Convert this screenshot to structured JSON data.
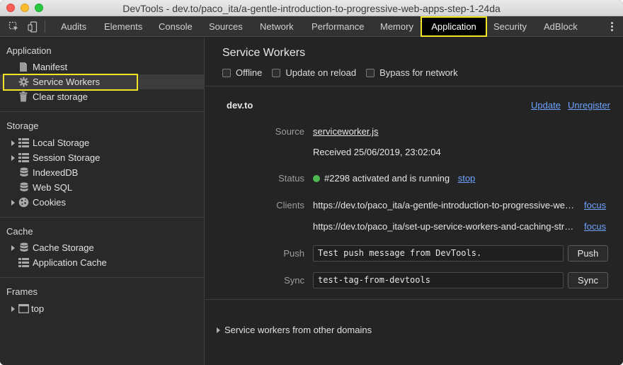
{
  "window": {
    "title": "DevTools - dev.to/paco_ita/a-gentle-introduction-to-progressive-web-apps-step-1-24da"
  },
  "toolbar": {
    "tabs": [
      "Audits",
      "Elements",
      "Console",
      "Sources",
      "Network",
      "Performance",
      "Memory",
      "Application",
      "Security",
      "AdBlock"
    ],
    "active_tab": "Application"
  },
  "sidebar": {
    "application": {
      "title": "Application",
      "items": [
        "Manifest",
        "Service Workers",
        "Clear storage"
      ],
      "selected": "Service Workers"
    },
    "storage": {
      "title": "Storage",
      "items": [
        "Local Storage",
        "Session Storage",
        "IndexedDB",
        "Web SQL",
        "Cookies"
      ]
    },
    "cache": {
      "title": "Cache",
      "items": [
        "Cache Storage",
        "Application Cache"
      ]
    },
    "frames": {
      "title": "Frames",
      "items": [
        "top"
      ]
    }
  },
  "main": {
    "title": "Service Workers",
    "checkboxes": {
      "offline": "Offline",
      "update_on_reload": "Update on reload",
      "bypass_for_network": "Bypass for network"
    },
    "origin": "dev.to",
    "update_link": "Update",
    "unregister_link": "Unregister",
    "source": {
      "label": "Source",
      "file": "serviceworker.js",
      "received": "Received 25/06/2019, 23:02:04"
    },
    "status": {
      "label": "Status",
      "text": "#2298 activated and is running",
      "stop_link": "stop"
    },
    "clients": {
      "label": "Clients",
      "items": [
        "https://dev.to/paco_ita/a-gentle-introduction-to-progressive-we…",
        "https://dev.to/paco_ita/set-up-service-workers-and-caching-str…"
      ],
      "focus_label": "focus"
    },
    "push": {
      "label": "Push",
      "value": "Test push message from DevTools.",
      "button": "Push"
    },
    "sync": {
      "label": "Sync",
      "value": "test-tag-from-devtools",
      "button": "Sync"
    },
    "other_domains": "Service workers from other domains"
  },
  "colors": {
    "highlight": "#f2e323",
    "link": "#6ea3ff",
    "status_running": "#4cba50"
  }
}
